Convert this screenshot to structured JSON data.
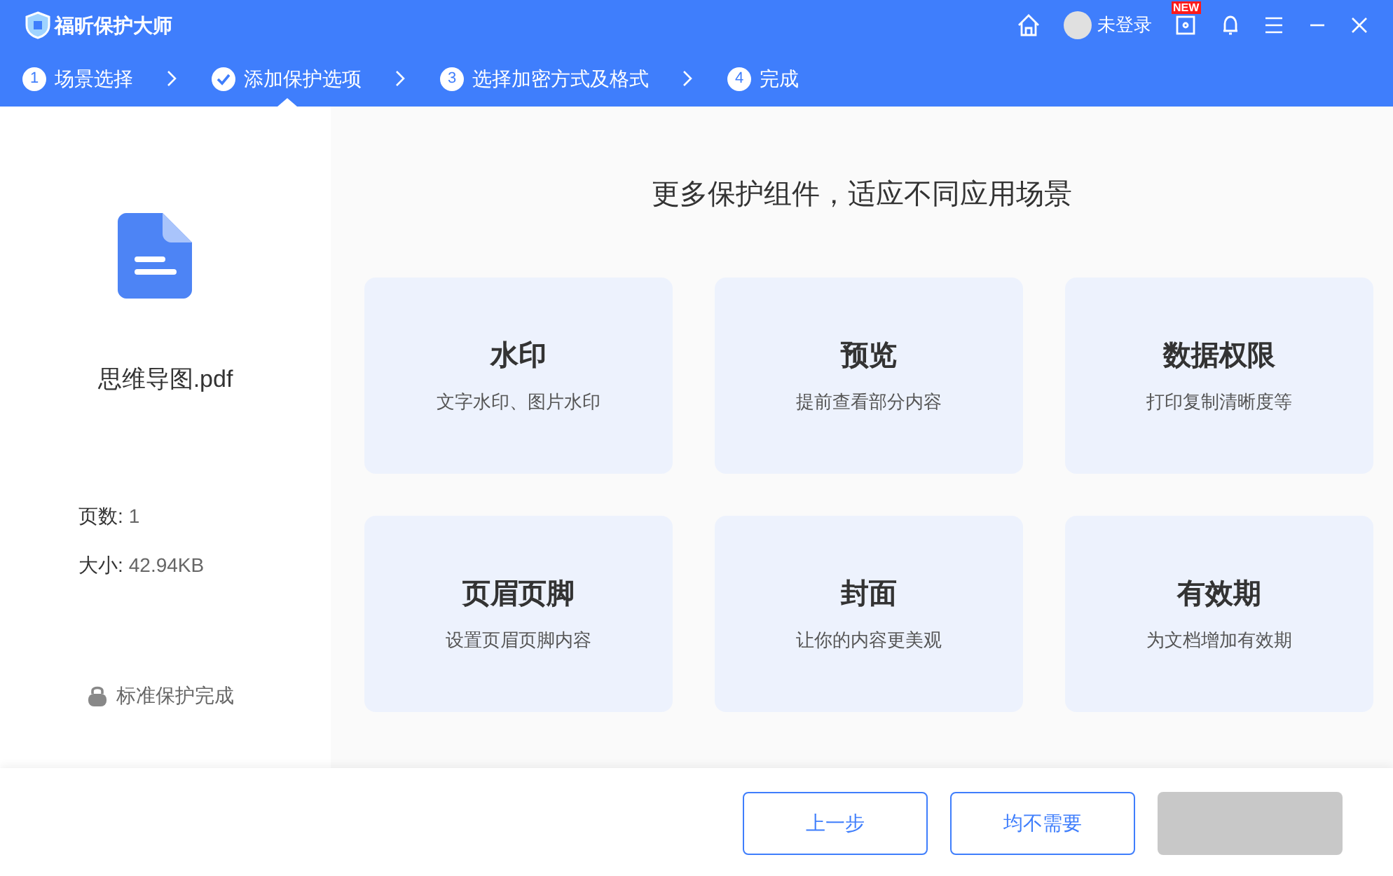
{
  "window": {
    "title": "福昕保护大师",
    "user": "未登录",
    "badge": "NEW"
  },
  "steps": [
    {
      "marker": "1",
      "kind": "number",
      "label": "场景选择",
      "selected": false
    },
    {
      "kind": "check",
      "label": "添加保护选项",
      "selected": true
    },
    {
      "marker": "3",
      "kind": "number",
      "label": "选择加密方式及格式",
      "selected": false
    },
    {
      "marker": "4",
      "kind": "number",
      "label": "完成",
      "selected": false
    }
  ],
  "file": {
    "name": "思维导图.pdf",
    "pages_label": "页数:",
    "pages": "1",
    "size_label": "大小:",
    "size": "42.94KB",
    "status": "标准保护完成"
  },
  "heading": "更多保护组件，适应不同应用场景",
  "cards": [
    {
      "title": "水印",
      "desc": "文字水印、图片水印"
    },
    {
      "title": "预览",
      "desc": "提前查看部分内容"
    },
    {
      "title": "数据权限",
      "desc": "打印复制清晰度等"
    },
    {
      "title": "页眉页脚",
      "desc": "设置页眉页脚内容"
    },
    {
      "title": "封面",
      "desc": "让你的内容更美观"
    },
    {
      "title": "有效期",
      "desc": "为文档增加有效期"
    }
  ],
  "buttons": [
    {
      "label": "上一步",
      "kind": "outline"
    },
    {
      "label": "均不需要",
      "kind": "outline"
    },
    {
      "kind": "disabled"
    }
  ]
}
